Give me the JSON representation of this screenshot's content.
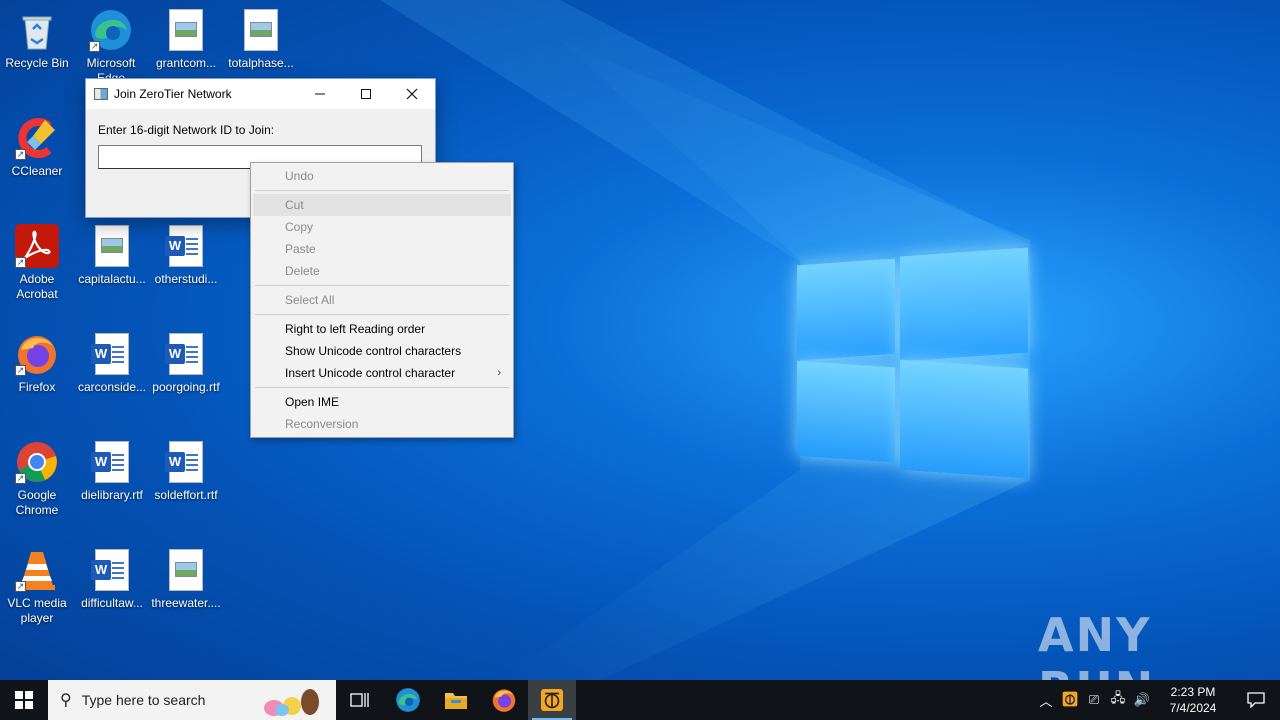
{
  "desktop": {
    "icons": [
      {
        "label": "Recycle Bin"
      },
      {
        "label": "Microsoft Edge"
      },
      {
        "label": "grantcom..."
      },
      {
        "label": "totalphase..."
      },
      {
        "label": "CCleaner"
      },
      {
        "label": "Adobe Acrobat"
      },
      {
        "label": "capitalactu..."
      },
      {
        "label": "otherstudi..."
      },
      {
        "label": "Firefox"
      },
      {
        "label": "carconside..."
      },
      {
        "label": "poorgoing.rtf"
      },
      {
        "label": "Google Chrome"
      },
      {
        "label": "dielibrary.rtf"
      },
      {
        "label": "soldeffort.rtf"
      },
      {
        "label": "VLC media player"
      },
      {
        "label": "difficultaw..."
      },
      {
        "label": "threewater...."
      }
    ]
  },
  "dialog": {
    "title": "Join ZeroTier Network",
    "prompt": "Enter 16-digit Network ID to Join:",
    "input_value": ""
  },
  "context_menu": {
    "items": [
      {
        "label": "Undo",
        "enabled": false
      },
      {
        "label": "Cut",
        "enabled": false
      },
      {
        "label": "Copy",
        "enabled": false
      },
      {
        "label": "Paste",
        "enabled": false
      },
      {
        "label": "Delete",
        "enabled": false
      },
      {
        "label": "Select All",
        "enabled": false
      },
      {
        "label": "Right to left Reading order",
        "enabled": true
      },
      {
        "label": "Show Unicode control characters",
        "enabled": true
      },
      {
        "label": "Insert Unicode control character",
        "enabled": true,
        "submenu": true
      },
      {
        "label": "Open IME",
        "enabled": true
      },
      {
        "label": "Reconversion",
        "enabled": false
      }
    ]
  },
  "watermark": "ANY RUN",
  "taskbar": {
    "search_placeholder": "Type here to search",
    "clock_time": "2:23 PM",
    "clock_date": "7/4/2024"
  },
  "colors": {
    "desktop_blue": "#0a6fd8",
    "taskbar": "#101418",
    "accent": "#76b9ed"
  }
}
